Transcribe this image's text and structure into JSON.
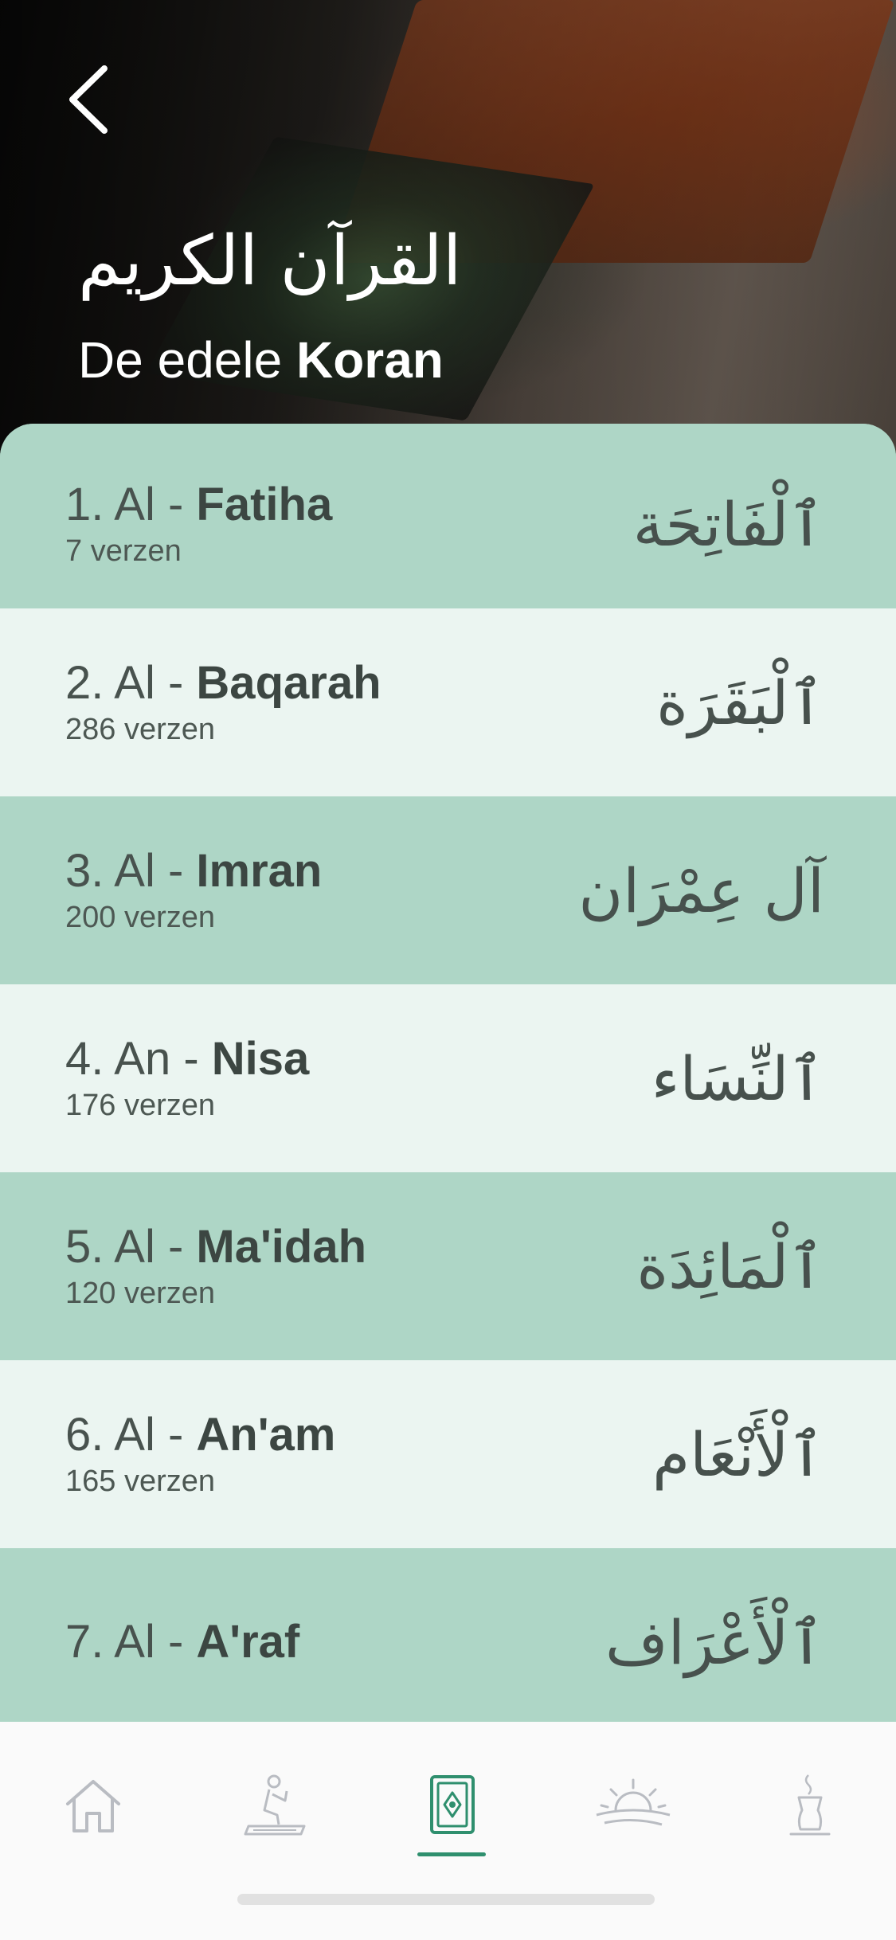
{
  "header": {
    "title_arabic": "القرآن الكريم",
    "title_prefix": "De edele ",
    "title_bold": "Koran"
  },
  "surahs": [
    {
      "number": "1.",
      "article": "Al",
      "name": "Fatiha",
      "verses": "7 verzen",
      "arabic": "ٱلْفَاتِحَة"
    },
    {
      "number": "2.",
      "article": "Al",
      "name": "Baqarah",
      "verses": "286 verzen",
      "arabic": "ٱلْبَقَرَة"
    },
    {
      "number": "3.",
      "article": "Al",
      "name": "Imran",
      "verses": "200 verzen",
      "arabic": "آل عِمْرَان"
    },
    {
      "number": "4.",
      "article": "An",
      "name": "Nisa",
      "verses": "176 verzen",
      "arabic": "ٱلنِّسَاء"
    },
    {
      "number": "5.",
      "article": "Al",
      "name": "Ma'idah",
      "verses": "120 verzen",
      "arabic": "ٱلْمَائِدَة"
    },
    {
      "number": "6.",
      "article": "Al",
      "name": "An'am",
      "verses": "165 verzen",
      "arabic": "ٱلْأَنْعَام"
    },
    {
      "number": "7.",
      "article": "Al",
      "name": "A'raf",
      "verses": "",
      "arabic": "ٱلْأَعْرَاف"
    }
  ],
  "tabs": [
    {
      "icon": "home-icon",
      "active": false
    },
    {
      "icon": "prayer-icon",
      "active": false
    },
    {
      "icon": "quran-icon",
      "active": true
    },
    {
      "icon": "sunrise-icon",
      "active": false
    },
    {
      "icon": "tea-icon",
      "active": false
    }
  ],
  "colors": {
    "row_dark": "#aed6c6",
    "row_light": "#ebf5f1",
    "accent": "#2f8f6e",
    "inactive_icon": "#b9bcc2"
  }
}
